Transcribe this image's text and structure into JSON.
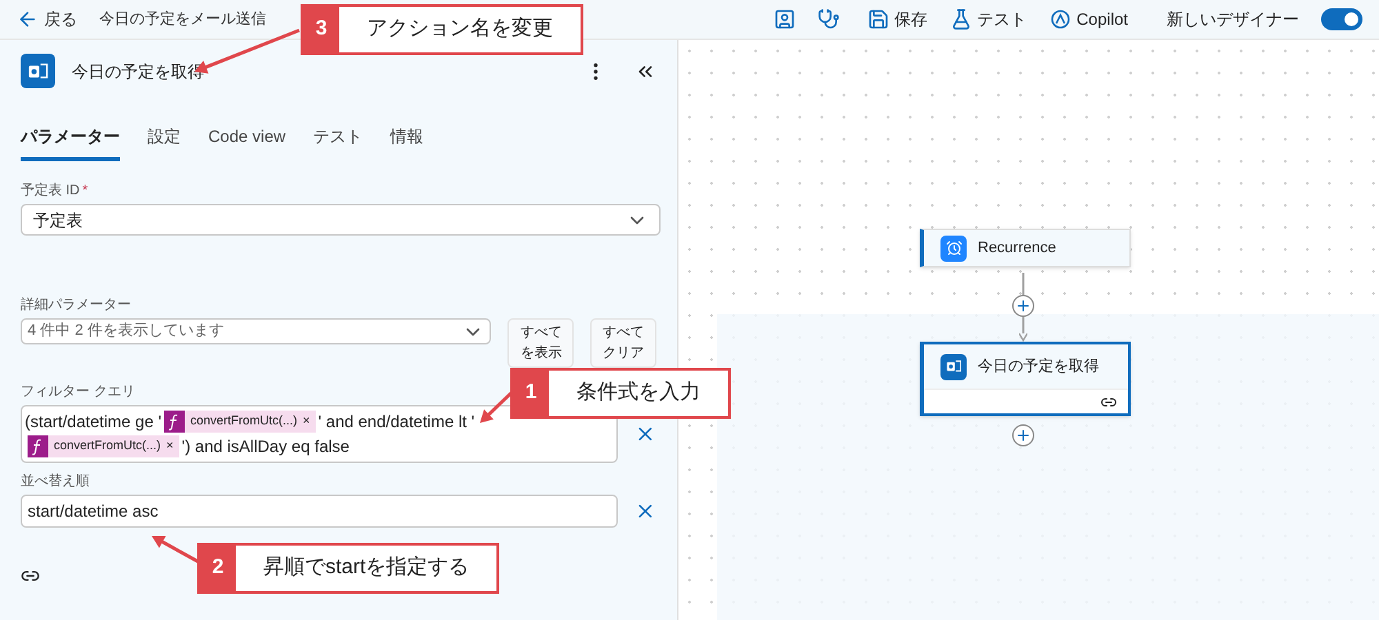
{
  "topbar": {
    "back": "戻る",
    "flow_title": "今日の予定をメール送信",
    "save": "保存",
    "test": "テスト",
    "copilot": "Copilot",
    "new_designer": {
      "label": "新しいデザイナー",
      "on": true
    }
  },
  "panel": {
    "title": "今日の予定を取得",
    "tabs": [
      {
        "label": "パラメーター",
        "selected": true
      },
      {
        "label": "設定",
        "selected": false
      },
      {
        "label": "Code view",
        "selected": false
      },
      {
        "label": "テスト",
        "selected": false
      },
      {
        "label": "情報",
        "selected": false
      }
    ],
    "calendar_id": {
      "label": "予定表 ID",
      "required_mark": "*",
      "value": "予定表"
    },
    "advanced": {
      "label": "詳細パラメーター",
      "value": "4 件中 2 件を表示しています",
      "buttons": [
        "すべてを表示",
        "すべてクリア"
      ]
    },
    "filter": {
      "label": "フィルター クエリ",
      "lines": [
        [
          {
            "kind": "text",
            "text": "(start/datetime ge '"
          },
          {
            "kind": "token",
            "text": "convertFromUtc(...)",
            "remove": "×"
          },
          {
            "kind": "text",
            "text": "' and end/datetime lt '"
          }
        ],
        [
          {
            "kind": "token",
            "text": "convertFromUtc(...)",
            "remove": "×"
          },
          {
            "kind": "text",
            "text": "') and isAllDay eq false"
          }
        ]
      ]
    },
    "order": {
      "label": "並べ替え順",
      "value": "start/datetime asc"
    }
  },
  "canvas": {
    "nodes": [
      {
        "kind": "trigger",
        "title": "Recurrence",
        "selected": false
      },
      {
        "kind": "outlook",
        "title": "今日の予定を取得",
        "selected": true
      }
    ]
  },
  "callouts": [
    {
      "number": "3",
      "text": "アクション名を変更"
    },
    {
      "number": "1",
      "text": "条件式を入力"
    },
    {
      "number": "2",
      "text": "昇順でstartを指定する"
    }
  ]
}
